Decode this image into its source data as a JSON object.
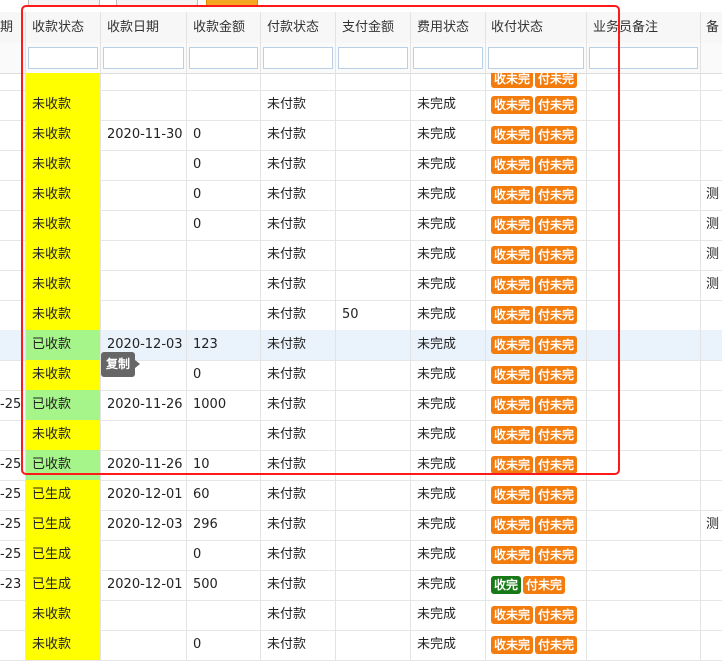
{
  "header": {
    "partial_first": "期",
    "columns": [
      "收款状态",
      "收款日期",
      "收款金额",
      "付款状态",
      "支付金额",
      "费用状态",
      "收付状态",
      "业务员备注"
    ],
    "partial_last": "备"
  },
  "tooltip": "复制",
  "colors": {
    "yellow": "#ffff00",
    "green": "#a5f58a",
    "tag_orange": "#f47c0c",
    "tag_green": "#177a17",
    "frame": "#ff1a1a"
  },
  "rows": [
    {
      "left": "",
      "recv_status": "",
      "recv_date": "",
      "recv_amount": "",
      "pay_status": "",
      "pay_amount": "",
      "fee_status": "",
      "tag1": "收未完",
      "tag2": "付未完",
      "note": "",
      "right": "",
      "recv_color": "yellow",
      "tag1_color": "orange",
      "partial": true
    },
    {
      "left": "",
      "recv_status": "未收款",
      "recv_date": "",
      "recv_amount": "",
      "pay_status": "未付款",
      "pay_amount": "",
      "fee_status": "未完成",
      "tag1": "收未完",
      "tag2": "付未完",
      "note": "",
      "right": "",
      "recv_color": "yellow",
      "tag1_color": "orange"
    },
    {
      "left": "",
      "recv_status": "未收款",
      "recv_date": "2020-11-30",
      "recv_amount": "0",
      "pay_status": "未付款",
      "pay_amount": "",
      "fee_status": "未完成",
      "tag1": "收未完",
      "tag2": "付未完",
      "note": "",
      "right": "",
      "recv_color": "yellow",
      "tag1_color": "orange"
    },
    {
      "left": "",
      "recv_status": "未收款",
      "recv_date": "",
      "recv_amount": "0",
      "pay_status": "未付款",
      "pay_amount": "",
      "fee_status": "未完成",
      "tag1": "收未完",
      "tag2": "付未完",
      "note": "",
      "right": "",
      "recv_color": "yellow",
      "tag1_color": "orange"
    },
    {
      "left": "",
      "recv_status": "未收款",
      "recv_date": "",
      "recv_amount": "0",
      "pay_status": "未付款",
      "pay_amount": "",
      "fee_status": "未完成",
      "tag1": "收未完",
      "tag2": "付未完",
      "note": "",
      "right": "测",
      "recv_color": "yellow",
      "tag1_color": "orange"
    },
    {
      "left": "",
      "recv_status": "未收款",
      "recv_date": "",
      "recv_amount": "0",
      "pay_status": "未付款",
      "pay_amount": "",
      "fee_status": "未完成",
      "tag1": "收未完",
      "tag2": "付未完",
      "note": "",
      "right": "测",
      "recv_color": "yellow",
      "tag1_color": "orange"
    },
    {
      "left": "",
      "recv_status": "未收款",
      "recv_date": "",
      "recv_amount": "",
      "pay_status": "未付款",
      "pay_amount": "",
      "fee_status": "未完成",
      "tag1": "收未完",
      "tag2": "付未完",
      "note": "",
      "right": "测",
      "recv_color": "yellow",
      "tag1_color": "orange"
    },
    {
      "left": "",
      "recv_status": "未收款",
      "recv_date": "",
      "recv_amount": "",
      "pay_status": "未付款",
      "pay_amount": "",
      "fee_status": "未完成",
      "tag1": "收未完",
      "tag2": "付未完",
      "note": "",
      "right": "测",
      "recv_color": "yellow",
      "tag1_color": "orange"
    },
    {
      "left": "",
      "recv_status": "未收款",
      "recv_date": "",
      "recv_amount": "",
      "pay_status": "未付款",
      "pay_amount": "50",
      "fee_status": "未完成",
      "tag1": "收未完",
      "tag2": "付未完",
      "note": "",
      "right": "",
      "recv_color": "yellow",
      "tag1_color": "orange"
    },
    {
      "left": "",
      "recv_status": "已收款",
      "recv_date": "2020-12-03",
      "recv_amount": "123",
      "pay_status": "未付款",
      "pay_amount": "",
      "fee_status": "未完成",
      "tag1": "收未完",
      "tag2": "付未完",
      "note": "",
      "right": "",
      "recv_color": "green",
      "tag1_color": "orange",
      "highlight": true
    },
    {
      "left": "",
      "recv_status": "未收款",
      "recv_date": "",
      "recv_amount": "0",
      "pay_status": "未付款",
      "pay_amount": "",
      "fee_status": "未完成",
      "tag1": "收未完",
      "tag2": "付未完",
      "note": "",
      "right": "",
      "recv_color": "yellow",
      "tag1_color": "orange"
    },
    {
      "left": "-25",
      "recv_status": "已收款",
      "recv_date": "2020-11-26",
      "recv_amount": "1000",
      "pay_status": "未付款",
      "pay_amount": "",
      "fee_status": "未完成",
      "tag1": "收未完",
      "tag2": "付未完",
      "note": "",
      "right": "",
      "recv_color": "green",
      "tag1_color": "orange"
    },
    {
      "left": "",
      "recv_status": "未收款",
      "recv_date": "",
      "recv_amount": "",
      "pay_status": "未付款",
      "pay_amount": "",
      "fee_status": "未完成",
      "tag1": "收未完",
      "tag2": "付未完",
      "note": "",
      "right": "",
      "recv_color": "yellow",
      "tag1_color": "orange"
    },
    {
      "left": "-25",
      "recv_status": "已收款",
      "recv_date": "2020-11-26",
      "recv_amount": "10",
      "pay_status": "未付款",
      "pay_amount": "",
      "fee_status": "未完成",
      "tag1": "收未完",
      "tag2": "付未完",
      "note": "",
      "right": "",
      "recv_color": "green",
      "tag1_color": "orange"
    },
    {
      "left": "-25",
      "recv_status": "已生成",
      "recv_date": "2020-12-01",
      "recv_amount": "60",
      "pay_status": "未付款",
      "pay_amount": "",
      "fee_status": "未完成",
      "tag1": "收未完",
      "tag2": "付未完",
      "note": "",
      "right": "",
      "recv_color": "yellow",
      "tag1_color": "orange"
    },
    {
      "left": "-25",
      "recv_status": "已生成",
      "recv_date": "2020-12-03",
      "recv_amount": "296",
      "pay_status": "未付款",
      "pay_amount": "",
      "fee_status": "未完成",
      "tag1": "收未完",
      "tag2": "付未完",
      "note": "",
      "right": "测",
      "recv_color": "yellow",
      "tag1_color": "orange"
    },
    {
      "left": "-25",
      "recv_status": "已生成",
      "recv_date": "",
      "recv_amount": "0",
      "pay_status": "未付款",
      "pay_amount": "",
      "fee_status": "未完成",
      "tag1": "收未完",
      "tag2": "付未完",
      "note": "",
      "right": "",
      "recv_color": "yellow",
      "tag1_color": "orange"
    },
    {
      "left": "-23",
      "recv_status": "已生成",
      "recv_date": "2020-12-01",
      "recv_amount": "500",
      "pay_status": "未付款",
      "pay_amount": "",
      "fee_status": "未完成",
      "tag1": "收完",
      "tag2": "付未完",
      "note": "",
      "right": "",
      "recv_color": "yellow",
      "tag1_color": "dgreen"
    },
    {
      "left": "",
      "recv_status": "未收款",
      "recv_date": "",
      "recv_amount": "",
      "pay_status": "未付款",
      "pay_amount": "",
      "fee_status": "未完成",
      "tag1": "收未完",
      "tag2": "付未完",
      "note": "",
      "right": "",
      "recv_color": "yellow",
      "tag1_color": "orange"
    },
    {
      "left": "",
      "recv_status": "未收款",
      "recv_date": "",
      "recv_amount": "0",
      "pay_status": "未付款",
      "pay_amount": "",
      "fee_status": "未完成",
      "tag1": "收未完",
      "tag2": "付未完",
      "note": "",
      "right": "",
      "recv_color": "yellow",
      "tag1_color": "orange"
    }
  ]
}
